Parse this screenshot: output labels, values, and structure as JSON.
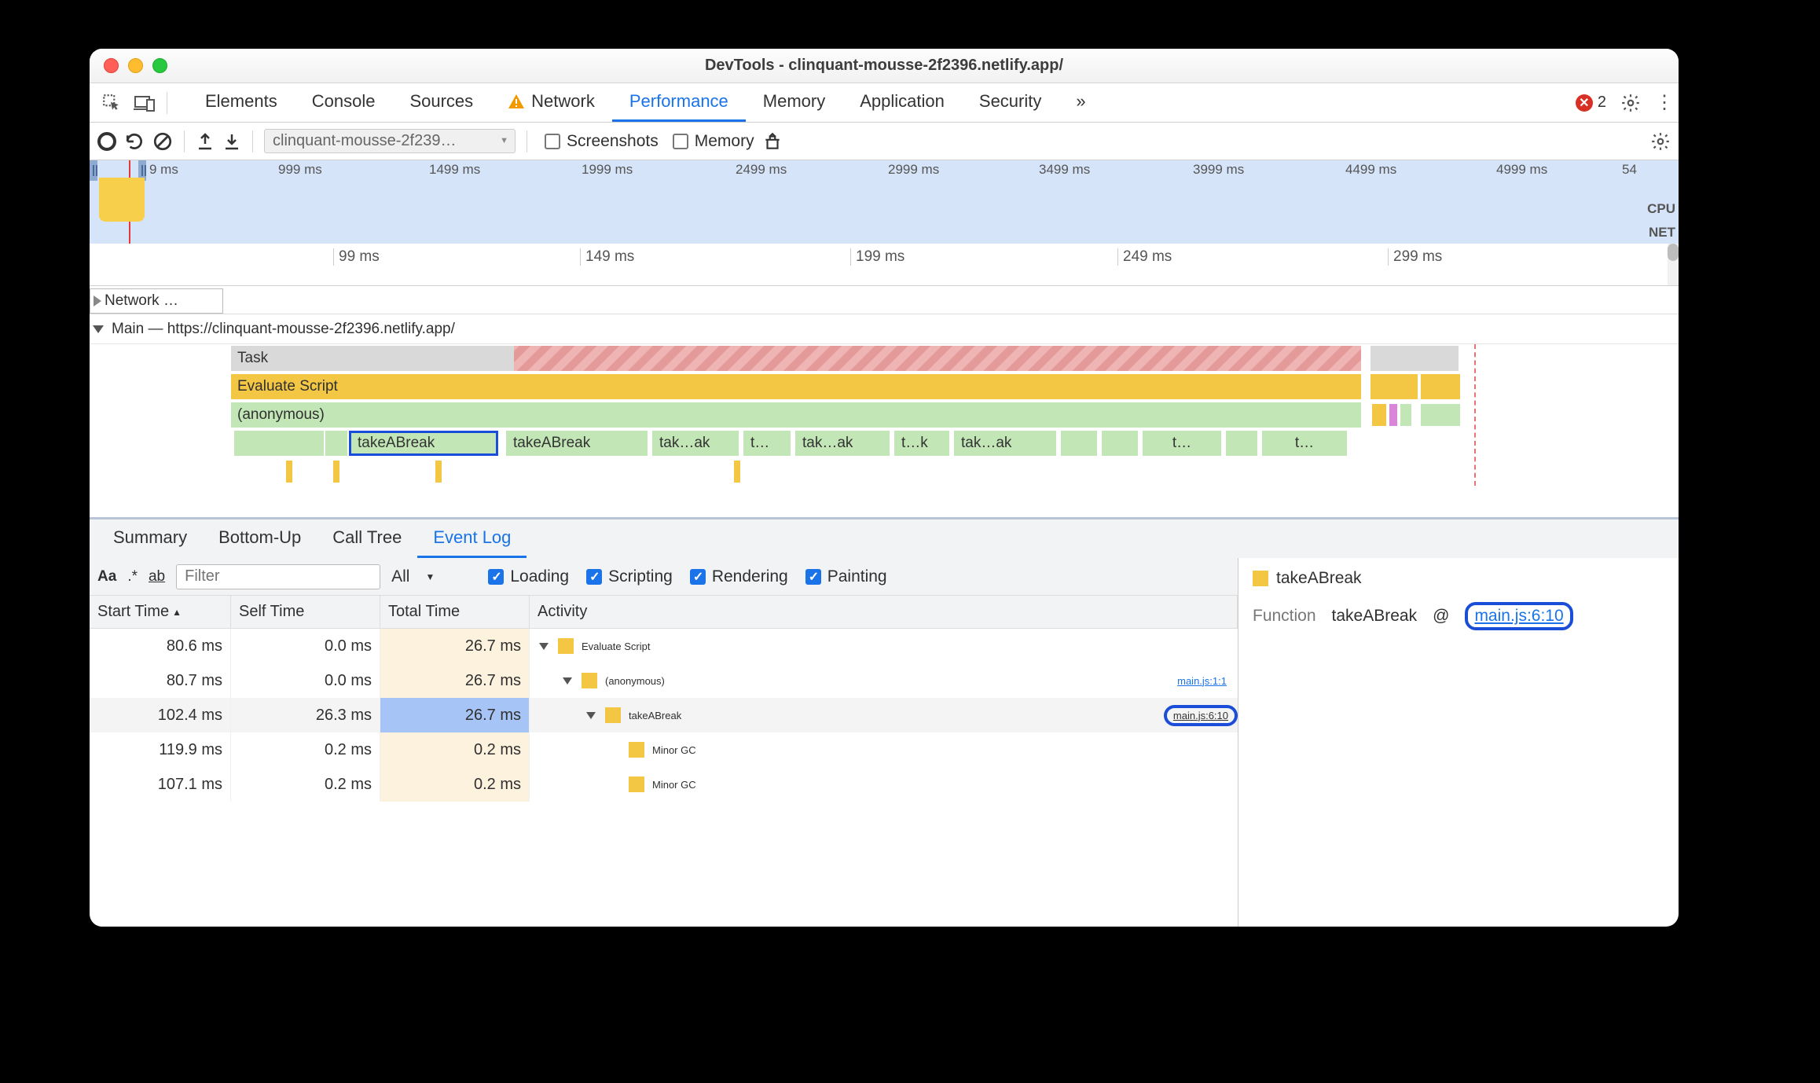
{
  "window": {
    "title": "DevTools - clinquant-mousse-2f2396.netlify.app/"
  },
  "tabs": {
    "elements": "Elements",
    "console": "Console",
    "sources": "Sources",
    "network": "Network",
    "performance": "Performance",
    "memory": "Memory",
    "application": "Application",
    "security": "Security",
    "more_glyph": "»",
    "active": "performance",
    "error_count": "2"
  },
  "toolbar": {
    "profile_label": "clinquant-mousse-2f239…",
    "screenshots_label": "Screenshots",
    "memory_label": "Memory"
  },
  "overview": {
    "ticks": [
      "9 ms",
      "999 ms",
      "1499 ms",
      "1999 ms",
      "2499 ms",
      "2999 ms",
      "3499 ms",
      "3999 ms",
      "4499 ms",
      "4999 ms",
      "54"
    ],
    "cpu_label": "CPU",
    "net_label": "NET"
  },
  "timeline_head": {
    "ticks": [
      "99 ms",
      "149 ms",
      "199 ms",
      "249 ms",
      "299 ms"
    ],
    "network_chip": "Network …"
  },
  "tracks": {
    "main_label": "Main — https://clinquant-mousse-2f2396.netlify.app/",
    "row_task": "Task",
    "row_eval": "Evaluate Script",
    "row_anon": "(anonymous)",
    "calls": [
      "takeABreak",
      "takeABreak",
      "tak…ak",
      "t…",
      "tak…ak",
      "t…k",
      "tak…ak",
      "t…",
      "t…"
    ]
  },
  "detail_tabs": {
    "summary": "Summary",
    "bottomup": "Bottom-Up",
    "calltree": "Call Tree",
    "eventlog": "Event Log",
    "active": "eventlog"
  },
  "filter": {
    "Aa": "Aa",
    "regex": ".*",
    "ab": "ab",
    "placeholder": "Filter",
    "all": "All",
    "loading": "Loading",
    "scripting": "Scripting",
    "rendering": "Rendering",
    "painting": "Painting"
  },
  "table": {
    "headers": {
      "start": "Start Time",
      "self": "Self Time",
      "total": "Total Time",
      "activity": "Activity"
    },
    "rows": [
      {
        "start": "80.6 ms",
        "self": "0.0 ms",
        "total": "26.7 ms",
        "indent": 0,
        "disclosure": true,
        "label": "Evaluate Script",
        "src": ""
      },
      {
        "start": "80.7 ms",
        "self": "0.0 ms",
        "total": "26.7 ms",
        "indent": 1,
        "disclosure": true,
        "label": "(anonymous)",
        "src": "main.js:1:1"
      },
      {
        "start": "102.4 ms",
        "self": "26.3 ms",
        "total": "26.7 ms",
        "indent": 2,
        "disclosure": true,
        "label": "takeABreak",
        "src": "main.js:6:10",
        "selected": true,
        "boxed": true
      },
      {
        "start": "119.9 ms",
        "self": "0.2 ms",
        "total": "0.2 ms",
        "indent": 3,
        "disclosure": false,
        "label": "Minor GC",
        "src": ""
      },
      {
        "start": "107.1 ms",
        "self": "0.2 ms",
        "total": "0.2 ms",
        "indent": 3,
        "disclosure": false,
        "label": "Minor GC",
        "src": ""
      }
    ]
  },
  "right_panel": {
    "title": "takeABreak",
    "label_function": "Function",
    "function_name": "takeABreak",
    "at": "@",
    "src": "main.js:6:10"
  }
}
